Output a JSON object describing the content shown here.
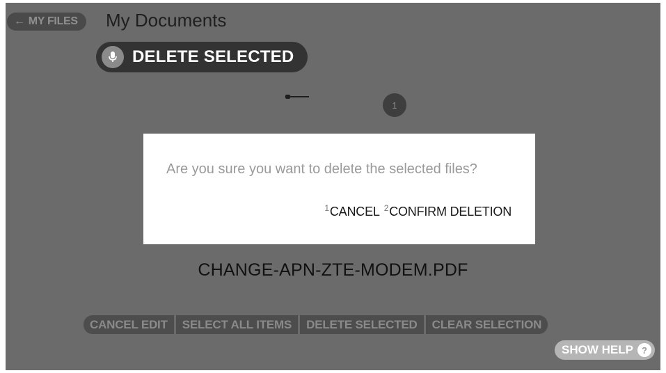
{
  "header": {
    "back_label": "MY FILES",
    "back_icon": "arrow-left-icon",
    "title": "My Documents"
  },
  "background": {
    "badge_number": "1"
  },
  "modal": {
    "question": "Are you sure you want to delete the selected files?",
    "actions": [
      {
        "number": "1",
        "label": "CANCEL"
      },
      {
        "number": "2",
        "label": "CONFIRM DELETION"
      }
    ]
  },
  "voice_command": {
    "icon": "microphone-icon",
    "text": "DELETE SELECTED"
  },
  "file": {
    "name": "CHANGE-APN-ZTE-MODEM.PDF"
  },
  "toolbar": {
    "cancel_edit": "CANCEL EDIT",
    "select_all": "SELECT ALL ITEMS",
    "delete_selected": "DELETE SELECTED",
    "clear_selection": "CLEAR SELECTION"
  },
  "help": {
    "label": "SHOW HELP",
    "icon_glyph": "?"
  }
}
